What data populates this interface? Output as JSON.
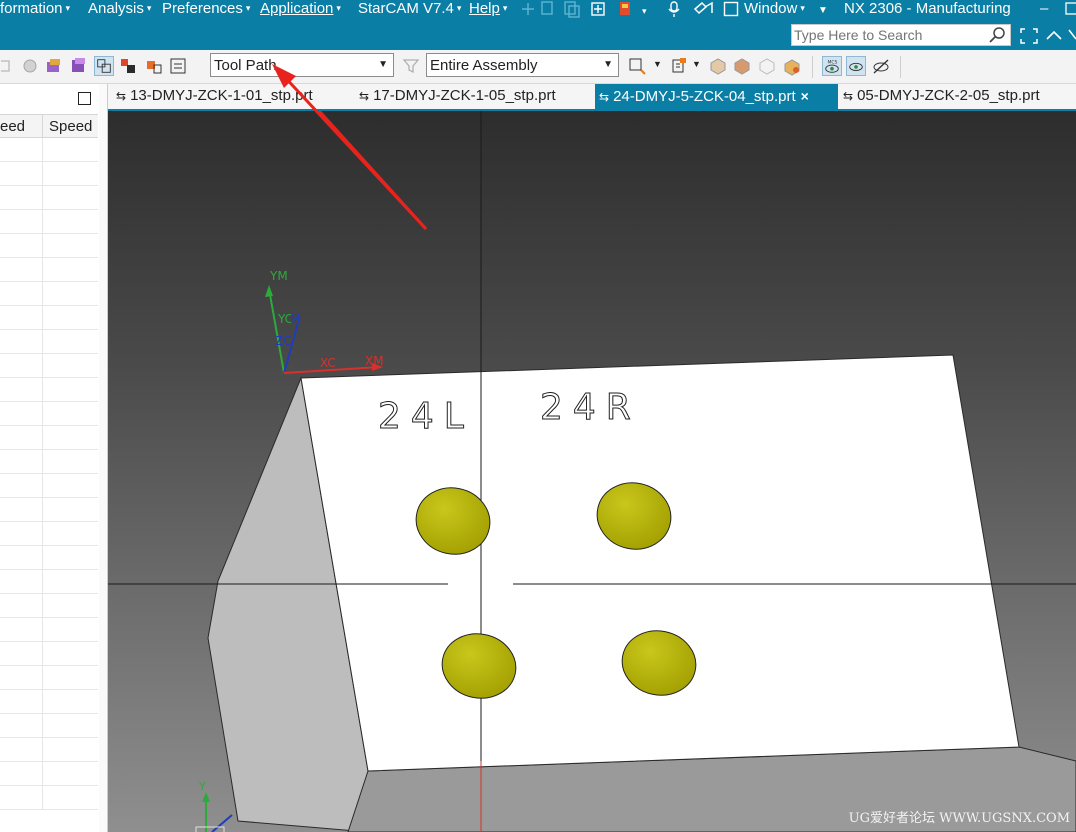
{
  "menubar": {
    "items": [
      {
        "label": "formation",
        "caret": "▾"
      },
      {
        "label": "Analysis",
        "caret": "▾"
      },
      {
        "label": "Preferences",
        "caret": "▾"
      },
      {
        "label": "Application",
        "caret": "▾"
      },
      {
        "label": "StarCAM V7.4",
        "caret": "▾"
      },
      {
        "label": "Help",
        "caret": "▾"
      },
      {
        "label": "Window",
        "caret": "▾"
      }
    ],
    "title": "NX 2306 - Manufacturing",
    "minimize": "–"
  },
  "search": {
    "placeholder": "Type Here to Search"
  },
  "toolbar": {
    "filter_combo": "Tool Path",
    "scope_combo": "Entire Assembly",
    "combo_arrow": "▼"
  },
  "left_panel": {
    "columns": [
      "eed",
      "Speed"
    ],
    "row_count": 28
  },
  "tabs": [
    {
      "label": "13-DMYJ-ZCK-1-01_stp.prt",
      "active": false
    },
    {
      "label": "17-DMYJ-ZCK-1-05_stp.prt",
      "active": false
    },
    {
      "label": "24-DMYJ-5-ZCK-04_stp.prt",
      "active": true,
      "close": "×"
    },
    {
      "label": "05-DMYJ-ZCK-2-05_stp.prt",
      "active": false
    }
  ],
  "viewport": {
    "part_text": [
      "24L",
      "24R"
    ],
    "axes": {
      "ym": "YM",
      "yc": "YC",
      "zm": "M",
      "zc": "ZC",
      "xc": "XC",
      "xm": "XM",
      "y": "Y"
    },
    "hole_color": "#b5b200",
    "accent": "#0a7ea4"
  },
  "watermark": "UG爱好者论坛 WWW.UGSNX.COM"
}
